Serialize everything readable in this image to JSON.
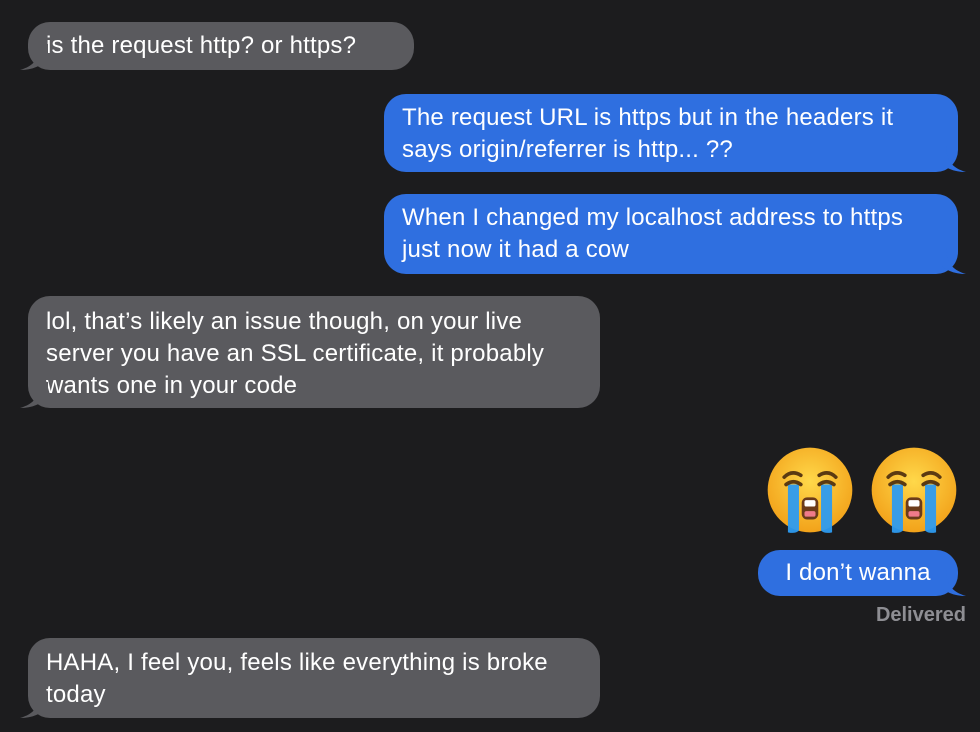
{
  "conversation": {
    "messages": [
      {
        "direction": "received",
        "text": "is the request http? or https?"
      },
      {
        "direction": "sent",
        "text": "The request URL is https but in the headers it says origin/referrer is http... ??"
      },
      {
        "direction": "sent",
        "text": "When I changed my localhost address to https just now it had a cow"
      },
      {
        "direction": "received",
        "text": "lol, that’s likely an issue though, on your live server you have an SSL certificate, it probably wants one in your code"
      },
      {
        "direction": "sent",
        "emoji": [
          "loudly-crying-face",
          "loudly-crying-face"
        ]
      },
      {
        "direction": "sent",
        "text": "I don’t wanna"
      },
      {
        "direction": "received",
        "text": "HAHA, I feel you, feels like everything is broke today"
      }
    ],
    "status": "Delivered"
  },
  "colors": {
    "background": "#1c1c1e",
    "received_bubble": "#5a5a5e",
    "sent_bubble": "#2f6fe0",
    "text": "#ffffff",
    "status_text": "#8e8e93"
  }
}
